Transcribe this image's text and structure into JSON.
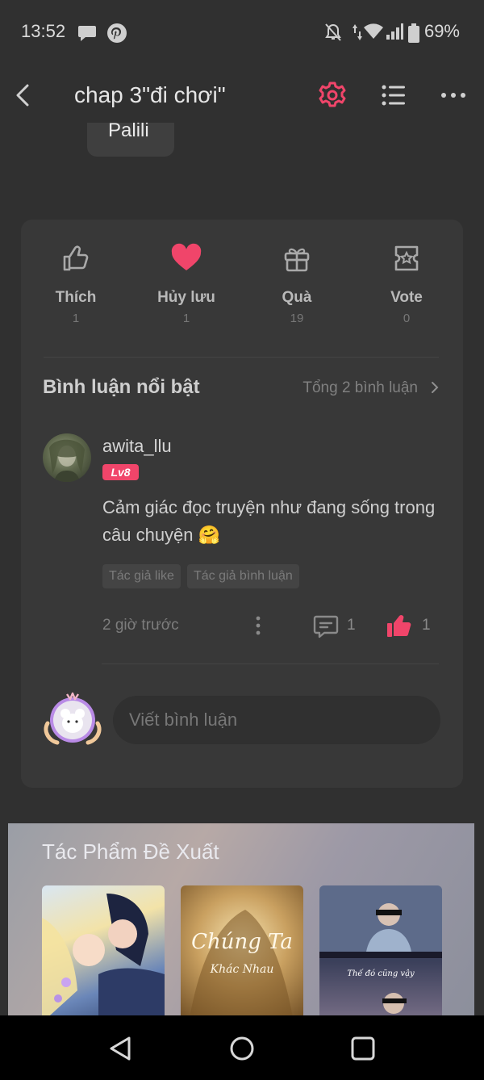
{
  "status": {
    "time": "13:52",
    "battery": "69%"
  },
  "header": {
    "title": "chap 3\"đi chơi\""
  },
  "content": {
    "bubble_text": "Palili"
  },
  "actions": [
    {
      "label": "Thích",
      "count": "1",
      "icon": "thumbs-up-icon"
    },
    {
      "label": "Hủy lưu",
      "count": "1",
      "icon": "heart-icon"
    },
    {
      "label": "Quà",
      "count": "19",
      "icon": "gift-icon"
    },
    {
      "label": "Vote",
      "count": "0",
      "icon": "vote-ticket-icon"
    }
  ],
  "comments": {
    "title": "Bình luận nổi bật",
    "total": "Tổng 2 bình luận",
    "item": {
      "username": "awita_llu",
      "level": "Lv8",
      "text": "Cảm giác đọc truyện như đang sống trong câu chuyện 🤗",
      "tags": [
        "Tác giả like",
        "Tác giả bình luận"
      ],
      "time": "2 giờ trước",
      "reply_count": "1",
      "like_count": "1"
    },
    "input_placeholder": "Viết bình luận"
  },
  "recommend": {
    "title": "Tác Phẩm Đề Xuất"
  },
  "colors": {
    "accent": "#f0456a",
    "background": "#303030",
    "card": "#383838"
  }
}
